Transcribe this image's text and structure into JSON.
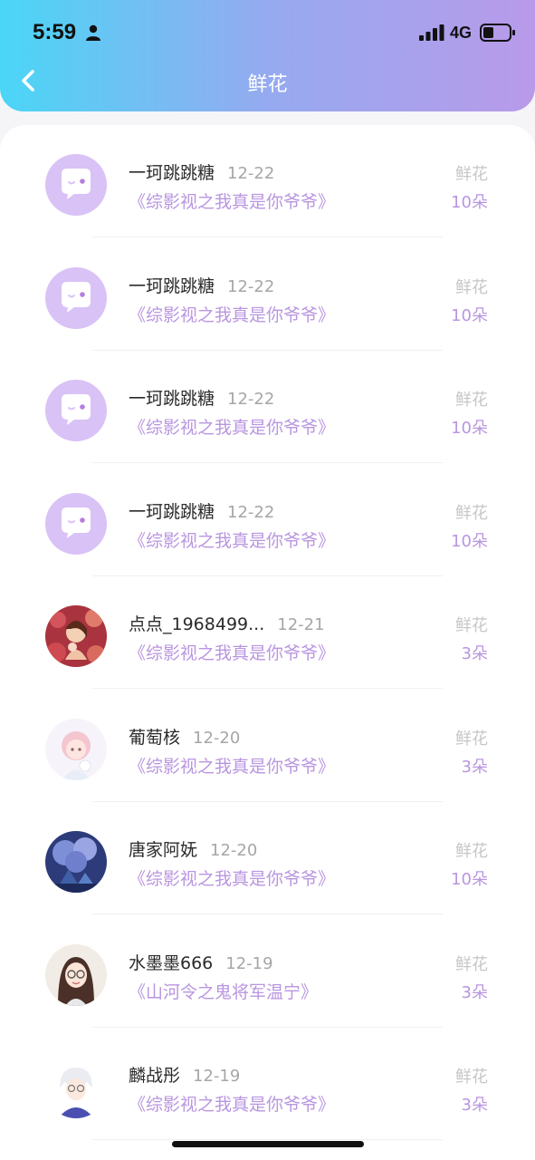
{
  "status_bar": {
    "time": "5:59",
    "network": "4G"
  },
  "nav": {
    "title": "鲜花"
  },
  "colors": {
    "accent": "#b996e0",
    "gradient_start": "#4ad6f6",
    "gradient_end": "#b99ae9"
  },
  "records": [
    {
      "name": "一珂跳跳糖",
      "date": "12-22",
      "book": "《综影视之我真是你爷爷》",
      "type": "鲜花",
      "amount": "10朵",
      "avatar": "default-chat-avatar"
    },
    {
      "name": "一珂跳跳糖",
      "date": "12-22",
      "book": "《综影视之我真是你爷爷》",
      "type": "鲜花",
      "amount": "10朵",
      "avatar": "default-chat-avatar"
    },
    {
      "name": "一珂跳跳糖",
      "date": "12-22",
      "book": "《综影视之我真是你爷爷》",
      "type": "鲜花",
      "amount": "10朵",
      "avatar": "default-chat-avatar"
    },
    {
      "name": "一珂跳跳糖",
      "date": "12-22",
      "book": "《综影视之我真是你爷爷》",
      "type": "鲜花",
      "amount": "10朵",
      "avatar": "default-chat-avatar"
    },
    {
      "name": "点点_1968499...",
      "date": "12-21",
      "book": "《综影视之我真是你爷爷》",
      "type": "鲜花",
      "amount": "3朵",
      "avatar": "flower-girl-avatar"
    },
    {
      "name": "葡萄核",
      "date": "12-20",
      "book": "《综影视之我真是你爷爷》",
      "type": "鲜花",
      "amount": "3朵",
      "avatar": "pink-girl-avatar"
    },
    {
      "name": "唐家阿妩",
      "date": "12-20",
      "book": "《综影视之我真是你爷爷》",
      "type": "鲜花",
      "amount": "10朵",
      "avatar": "blue-tree-avatar"
    },
    {
      "name": "水墨墨666",
      "date": "12-19",
      "book": "《山河令之鬼将军温宁》",
      "type": "鲜花",
      "amount": "3朵",
      "avatar": "glasses-girl-avatar"
    },
    {
      "name": "麟战彤",
      "date": "12-19",
      "book": "《综影视之我真是你爷爷》",
      "type": "鲜花",
      "amount": "3朵",
      "avatar": "white-hair-avatar"
    }
  ]
}
